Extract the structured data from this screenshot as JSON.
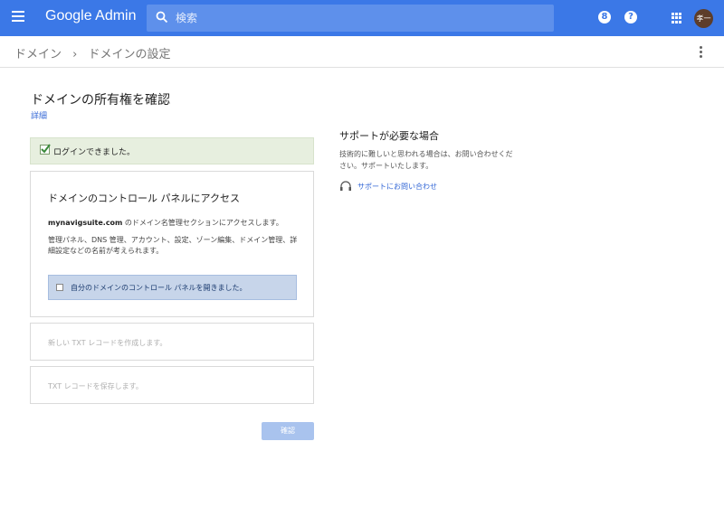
{
  "topbar": {
    "brand": "Google Admin",
    "search_placeholder": "検索",
    "badge_count": "8",
    "help_glyph": "?",
    "avatar_initials": "孝一",
    "bar_color": "#3b78e7"
  },
  "breadcrumb": {
    "items": [
      "ドメイン",
      "ドメインの設定"
    ],
    "separator": "›"
  },
  "main": {
    "title": "ドメインの所有権を確認",
    "detail_link": "詳細",
    "success_message": "ログインできました。",
    "step1": {
      "heading": "ドメインのコントロール パネルにアクセス",
      "domain": "mynavigsuite.com",
      "text1_suffix": " のドメイン名管理セクションにアクセスします。",
      "text2": "管理パネル、DNS 管理、アカウント、設定、ゾーン編集、ドメイン管理、詳細設定などの名前が考えられます。",
      "checkbox_label": "自分のドメインのコントロール パネルを開きました。"
    },
    "step2": {
      "text": "新しい TXT レコードを作成します。"
    },
    "step3": {
      "text": "TXT レコードを保存します。"
    },
    "confirm_button": "確認"
  },
  "support": {
    "title": "サポートが必要な場合",
    "text": "技術的に難しいと思われる場合は、お問い合わせください。サポートいたします。",
    "link": "サポートにお問い合わせ"
  }
}
